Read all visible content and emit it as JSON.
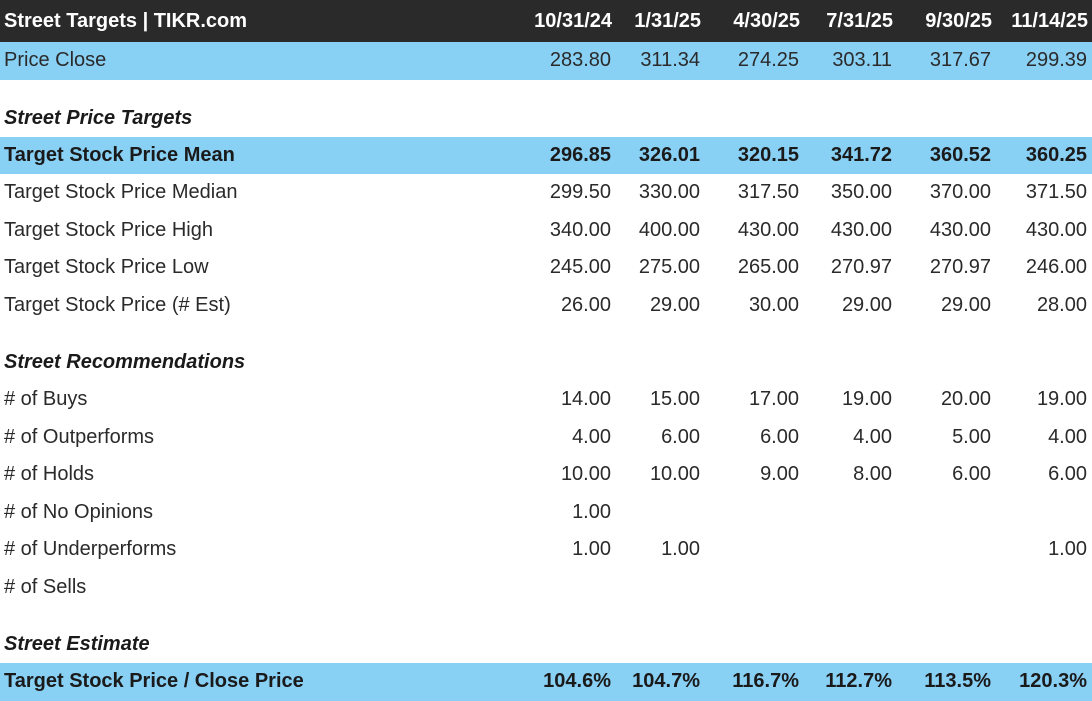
{
  "header": {
    "title": "Street Targets | TIKR.com",
    "dates": [
      "10/31/24",
      "1/31/25",
      "4/30/25",
      "7/31/25",
      "9/30/25",
      "11/14/25"
    ]
  },
  "rows": {
    "price_close": {
      "label": "Price Close",
      "values": [
        "283.80",
        "311.34",
        "274.25",
        "303.11",
        "317.67",
        "299.39"
      ]
    },
    "section_targets": {
      "label": "Street Price Targets"
    },
    "target_mean": {
      "label": "Target Stock Price Mean",
      "values": [
        "296.85",
        "326.01",
        "320.15",
        "341.72",
        "360.52",
        "360.25"
      ]
    },
    "target_median": {
      "label": "Target Stock Price Median",
      "values": [
        "299.50",
        "330.00",
        "317.50",
        "350.00",
        "370.00",
        "371.50"
      ]
    },
    "target_high": {
      "label": "Target Stock Price High",
      "values": [
        "340.00",
        "400.00",
        "430.00",
        "430.00",
        "430.00",
        "430.00"
      ]
    },
    "target_low": {
      "label": "Target Stock Price Low",
      "values": [
        "245.00",
        "275.00",
        "265.00",
        "270.97",
        "270.97",
        "246.00"
      ]
    },
    "target_est": {
      "label": "Target Stock Price (# Est)",
      "values": [
        "26.00",
        "29.00",
        "30.00",
        "29.00",
        "29.00",
        "28.00"
      ]
    },
    "section_recs": {
      "label": "Street Recommendations"
    },
    "buys": {
      "label": "# of Buys",
      "values": [
        "14.00",
        "15.00",
        "17.00",
        "19.00",
        "20.00",
        "19.00"
      ]
    },
    "outperforms": {
      "label": "# of Outperforms",
      "values": [
        "4.00",
        "6.00",
        "6.00",
        "4.00",
        "5.00",
        "4.00"
      ]
    },
    "holds": {
      "label": "# of Holds",
      "values": [
        "10.00",
        "10.00",
        "9.00",
        "8.00",
        "6.00",
        "6.00"
      ]
    },
    "no_opinions": {
      "label": "# of No Opinions",
      "values": [
        "1.00",
        "",
        "",
        "",
        "",
        ""
      ]
    },
    "underperforms": {
      "label": "# of Underperforms",
      "values": [
        "1.00",
        "1.00",
        "",
        "",
        "",
        "1.00"
      ]
    },
    "sells": {
      "label": "# of Sells",
      "values": [
        "",
        "",
        "",
        "",
        "",
        ""
      ]
    },
    "section_estimate": {
      "label": "Street Estimate"
    },
    "target_close": {
      "label": "Target Stock Price / Close Price",
      "values": [
        "104.6%",
        "104.7%",
        "116.7%",
        "112.7%",
        "113.5%",
        "120.3%"
      ]
    }
  },
  "colors": {
    "header_bg": "#2a2a2a",
    "highlight_bg": "#89d0f5"
  }
}
